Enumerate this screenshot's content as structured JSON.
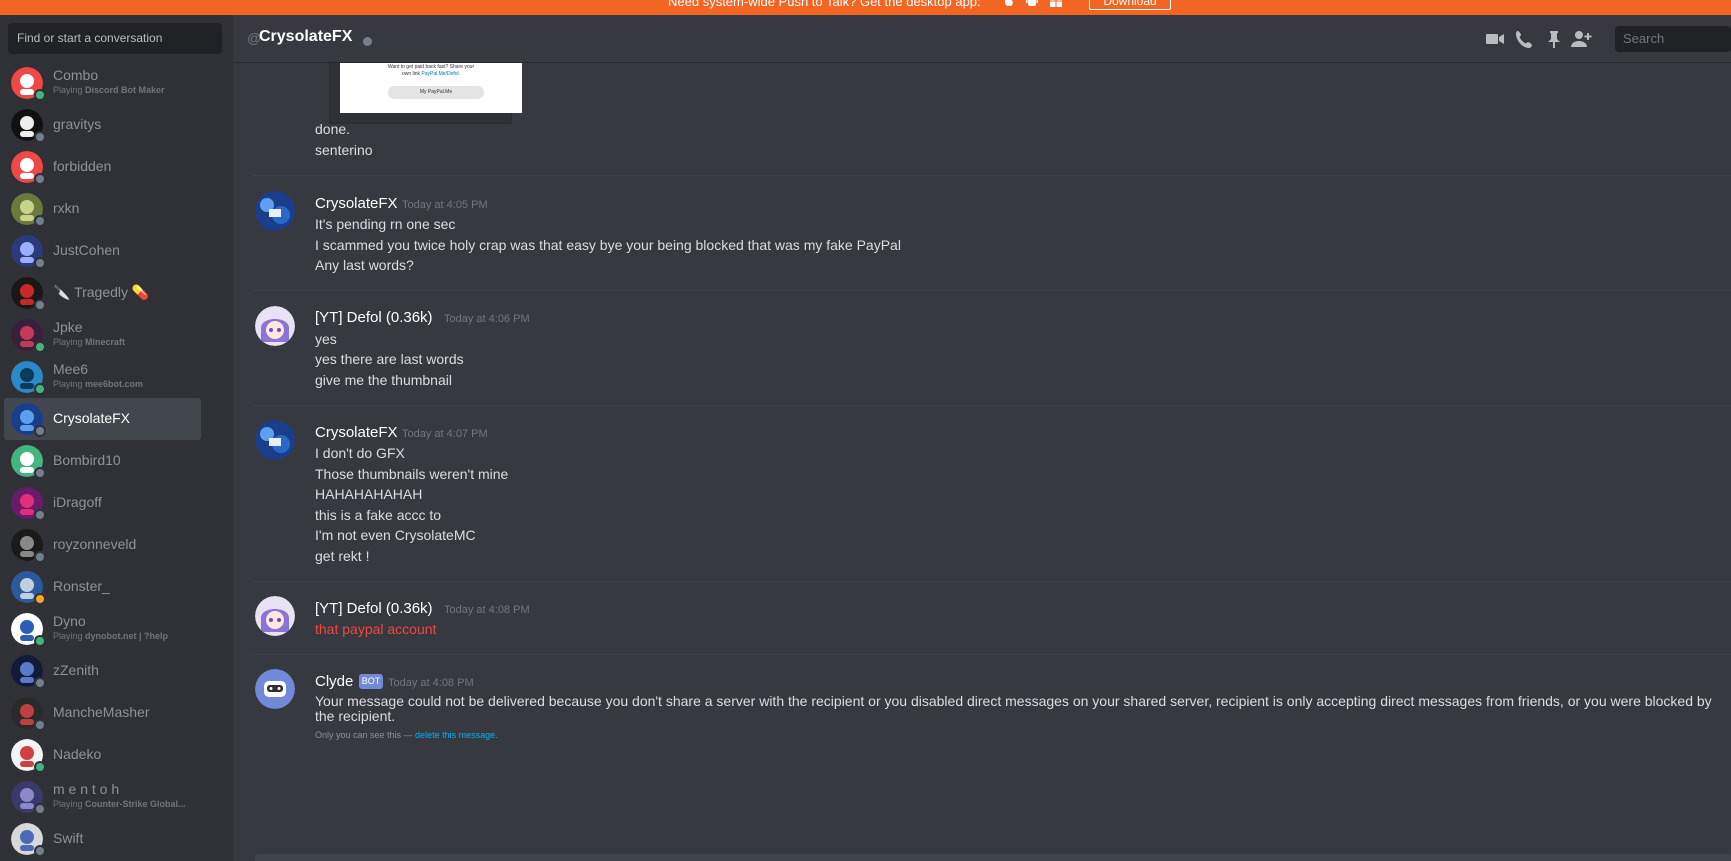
{
  "banner": {
    "text": "Need system-wide Push to Talk? Get the desktop app:",
    "download_label": "Download"
  },
  "sidebar": {
    "search_placeholder": "Find or start a conversation",
    "items": [
      {
        "name": "Combo",
        "activity_prefix": "Playing ",
        "activity": "Discord Bot Maker",
        "status": "online"
      },
      {
        "name": "gravitys",
        "status": "offline"
      },
      {
        "name": "forbidden",
        "status": "offline"
      },
      {
        "name": "rxkn",
        "status": "offline"
      },
      {
        "name": "JustCohen",
        "status": "offline"
      },
      {
        "name": "🔪 Tragedly 💊",
        "status": "offline"
      },
      {
        "name": "Jpke",
        "activity_prefix": "Playing ",
        "activity": "Minecraft",
        "status": "online"
      },
      {
        "name": "Mee6",
        "activity_prefix": "Playing ",
        "activity": "mee6bot.com",
        "status": "online"
      },
      {
        "name": "CrysolateFX",
        "status": "offline",
        "selected": true
      },
      {
        "name": "Bombird10",
        "status": "offline"
      },
      {
        "name": "iDragoff",
        "status": "offline"
      },
      {
        "name": "royzonneveld",
        "status": "offline"
      },
      {
        "name": "Ronster_",
        "status": "idle"
      },
      {
        "name": "Dyno",
        "activity_prefix": "Playing ",
        "activity": "dynobot.net | ?help",
        "status": "online"
      },
      {
        "name": "zZenith",
        "status": "offline"
      },
      {
        "name": "MancheMasher",
        "status": "offline"
      },
      {
        "name": "Nadeko",
        "status": "online"
      },
      {
        "name": "m e n t o h",
        "activity_prefix": "Playing ",
        "activity": "Counter-Strike Global...",
        "status": "offline"
      },
      {
        "name": "Swift",
        "status": "offline"
      }
    ]
  },
  "header": {
    "at": "@",
    "title": "CrysolateFX",
    "search_placeholder": "Search",
    "icons": [
      "video-icon",
      "phone-icon",
      "pin-icon",
      "add-friend-icon"
    ]
  },
  "embed": {
    "line1": "Want to get paid back fast? Share your",
    "line2_prefix": "own link ",
    "line2_link": "PayPal.Me/Defol.",
    "button": "My PayPal.Me"
  },
  "messages": {
    "cont": [
      "done.",
      "senterino"
    ],
    "m1": {
      "author": "CrysolateFX",
      "time": "Today at 4:05 PM",
      "lines": [
        "It's pending rn one sec",
        "I scammed you twice holy crap was that easy bye your being blocked that was my fake PayPal",
        "Any last words?"
      ]
    },
    "m2": {
      "author": "[YT] Defol (0.36k)",
      "time": "Today at 4:06 PM",
      "lines": [
        "yes",
        "yes there are last words",
        "give me the thumbnail"
      ]
    },
    "m3": {
      "author": "CrysolateFX",
      "time": "Today at 4:07 PM",
      "lines": [
        "I don't do GFX",
        "Those thumbnails weren't mine",
        "HAHAHAHAHAH",
        "this is a fake accc to",
        "I'm not even CrysolateMC",
        "get rekt !"
      ]
    },
    "m4": {
      "author": "[YT] Defol (0.36k)",
      "time": "Today at 4:08 PM",
      "lines": [
        "that paypal account"
      ]
    },
    "m5": {
      "author": "Clyde",
      "bot_tag": "BOT",
      "time": "Today at 4:08 PM",
      "text": "Your message could not be delivered because you don't share a server with the recipient or you disabled direct messages on your shared server, recipient is only accepting direct messages from friends, or you were blocked by the recipient.",
      "ephemeral_prefix": "Only you can see this — ",
      "ephemeral_link": "delete this message."
    }
  },
  "colors": {
    "banner": "#f26522",
    "online": "#43b581",
    "idle": "#faa61a",
    "offline": "#747f8d",
    "error_text": "#f04747",
    "blurple": "#7289da"
  }
}
